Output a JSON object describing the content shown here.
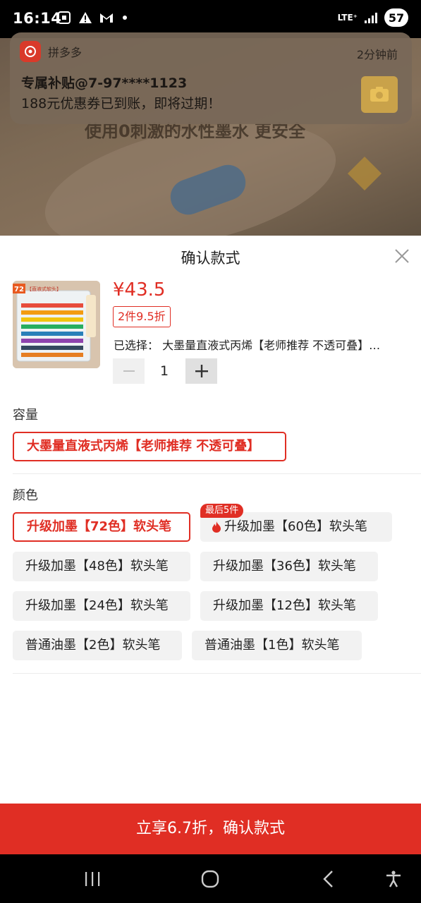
{
  "status_bar": {
    "time": "16:14",
    "network": "LTE⁺",
    "battery": "57"
  },
  "background": {
    "headline": "使用0刺激的水性墨水 更安全"
  },
  "notification": {
    "app_name": "拼多多",
    "time": "2分钟前",
    "title": "专属补贴@7-97****1123",
    "body": "188元优惠券已到账，即将过期！"
  },
  "sheet": {
    "title": "确认款式",
    "product": {
      "price": "¥43.5",
      "promo": "2件9.5折",
      "selected": "已选择：  大墨量直液式丙烯【老师推荐 不透可叠】…",
      "image_label_count": "72",
      "image_label_text": "【直液式软头】"
    },
    "quantity": {
      "value": "1"
    },
    "capacity": {
      "label": "容量",
      "options": [
        {
          "label": "大墨量直液式丙烯【老师推荐 不透可叠】",
          "selected": true
        }
      ]
    },
    "color": {
      "label": "颜色",
      "last_tag": "最后5件",
      "options": [
        {
          "label": "升级加墨【72色】软头笔",
          "selected": true
        },
        {
          "label": "升级加墨【60色】软头笔",
          "selected": false
        },
        {
          "label": "升级加墨【48色】软头笔",
          "selected": false
        },
        {
          "label": "升级加墨【36色】软头笔",
          "selected": false
        },
        {
          "label": "升级加墨【24色】软头笔",
          "selected": false
        },
        {
          "label": "升级加墨【12色】软头笔",
          "selected": false
        },
        {
          "label": "普通油墨【2色】软头笔",
          "selected": false
        },
        {
          "label": "普通油墨【1色】软头笔",
          "selected": false
        }
      ]
    },
    "confirm_button": "立享6.7折，确认款式"
  },
  "colors": {
    "accent": "#e02e24",
    "option_bg": "#f2f2f2"
  }
}
